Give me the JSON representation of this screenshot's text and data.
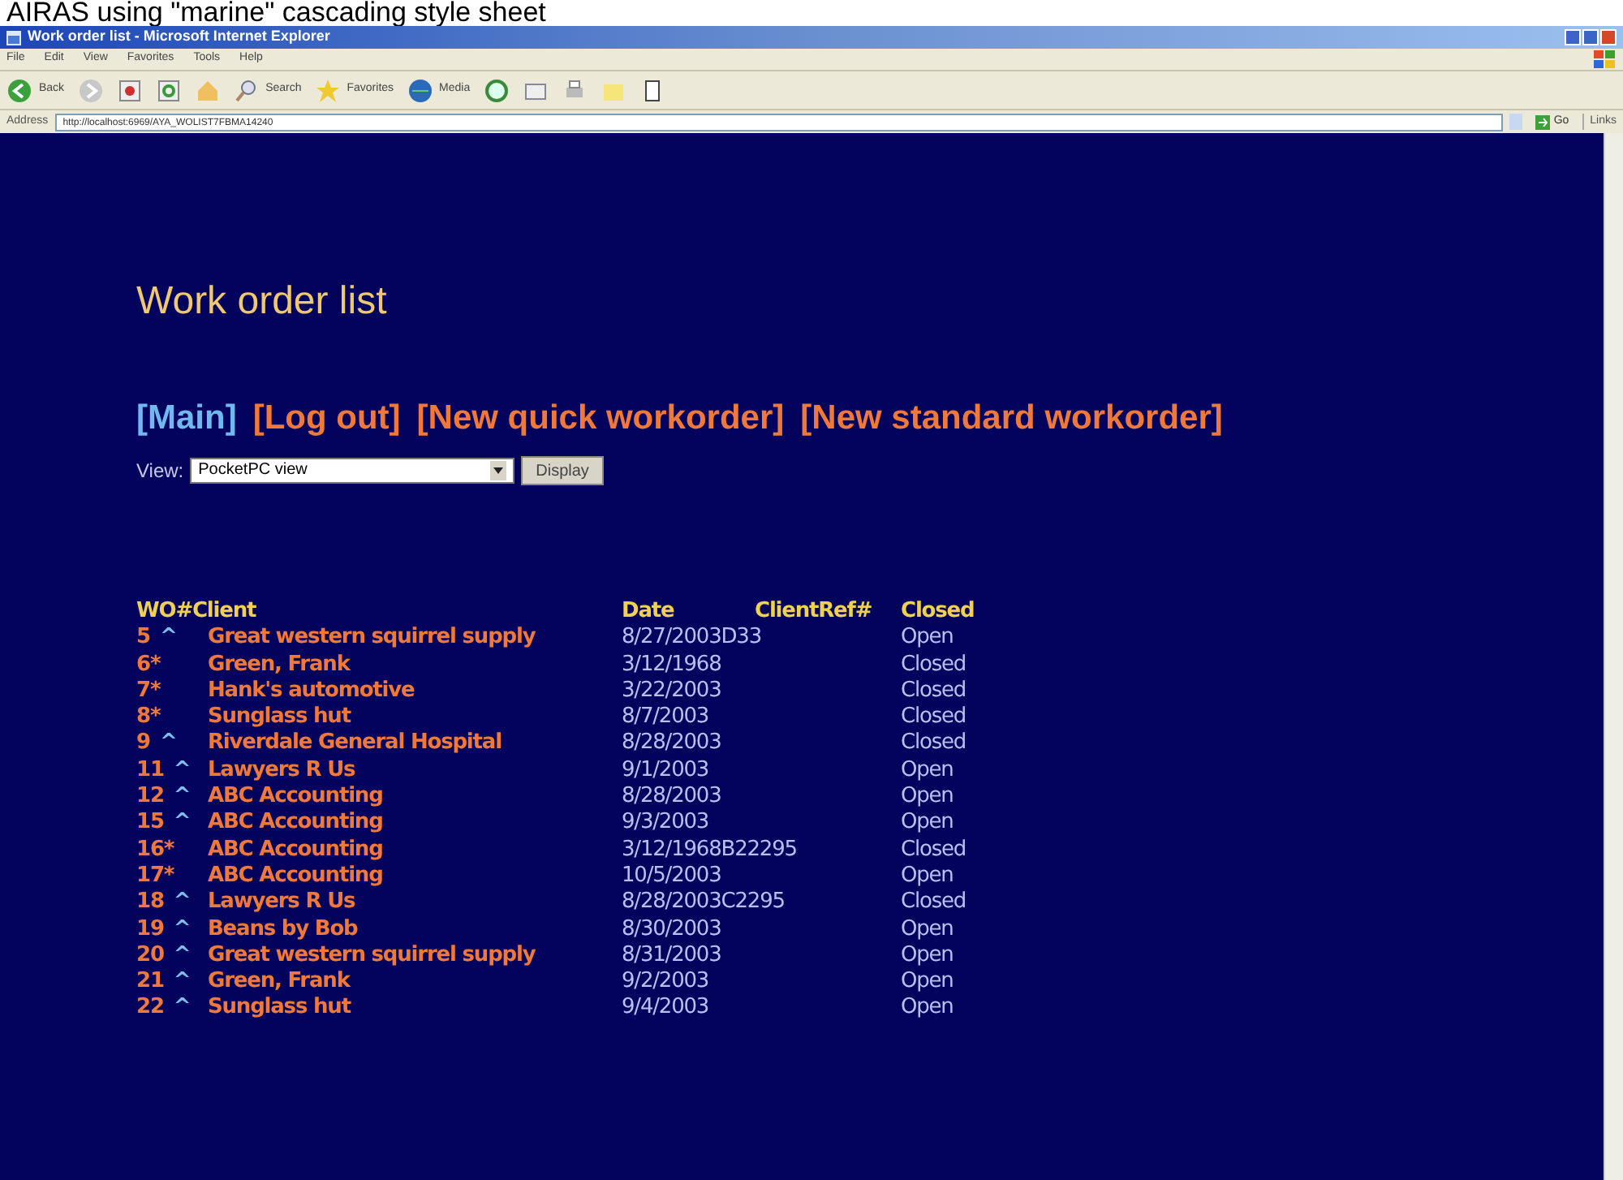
{
  "caption": "AIRAS using \"marine\" cascading style sheet",
  "window": {
    "title": "Work order list - Microsoft Internet Explorer"
  },
  "menu": [
    "File",
    "Edit",
    "View",
    "Favorites",
    "Tools",
    "Help"
  ],
  "toolbar": [
    {
      "kind": "back",
      "label": "Back"
    },
    {
      "kind": "forward"
    },
    {
      "kind": "stop"
    },
    {
      "kind": "refresh"
    },
    {
      "kind": "home"
    },
    {
      "kind": "search",
      "label": "Search"
    },
    {
      "kind": "favorites",
      "label": "Favorites"
    },
    {
      "kind": "media",
      "label": "Media"
    },
    {
      "kind": "history"
    },
    {
      "kind": "mail"
    },
    {
      "kind": "print"
    },
    {
      "kind": "folder"
    },
    {
      "kind": "page"
    }
  ],
  "address": {
    "label": "Address",
    "value": "http://localhost:6969/AYA_WOLIST7FBMA14240",
    "go": "Go",
    "links": "Links"
  },
  "page": {
    "heading": "Work order list",
    "nav": [
      {
        "label": "[Main]",
        "current": true
      },
      {
        "label": "[Log out]",
        "current": false
      },
      {
        "label": "[New quick workorder]",
        "current": false
      },
      {
        "label": "[New standard workorder]",
        "current": false
      }
    ],
    "view": {
      "label": "View:",
      "value": "PocketPC view",
      "button": "Display"
    },
    "table": {
      "columns": [
        "WO#",
        "Client",
        "Date",
        "ClientRef#",
        "Closed"
      ],
      "rows": [
        {
          "wo": "5",
          "kind": "caret",
          "mark": "^",
          "client": "Great western squirrel supply",
          "date": "8/27/2003",
          "ref": "D33",
          "closed": "Open"
        },
        {
          "wo": "6",
          "kind": "star",
          "mark": "*",
          "client": "Green, Frank",
          "date": "3/12/1968",
          "ref": "",
          "closed": "Closed"
        },
        {
          "wo": "7",
          "kind": "star",
          "mark": "*",
          "client": "Hank's automotive",
          "date": "3/22/2003",
          "ref": "",
          "closed": "Closed"
        },
        {
          "wo": "8",
          "kind": "star",
          "mark": "*",
          "client": "Sunglass hut",
          "date": "8/7/2003",
          "ref": "",
          "closed": "Closed"
        },
        {
          "wo": "9",
          "kind": "caret",
          "mark": "^",
          "client": "Riverdale General Hospital",
          "date": "8/28/2003",
          "ref": "",
          "closed": "Closed"
        },
        {
          "wo": "11",
          "kind": "caret",
          "mark": "^",
          "client": "Lawyers R Us",
          "date": "9/1/2003",
          "ref": "",
          "closed": "Open"
        },
        {
          "wo": "12",
          "kind": "caret",
          "mark": "^",
          "client": "ABC Accounting",
          "date": "8/28/2003",
          "ref": "",
          "closed": "Open"
        },
        {
          "wo": "15",
          "kind": "caret",
          "mark": "^",
          "client": "ABC Accounting",
          "date": "9/3/2003",
          "ref": "",
          "closed": "Open"
        },
        {
          "wo": "16",
          "kind": "star",
          "mark": "*",
          "client": "ABC Accounting",
          "date": "3/12/1968",
          "ref": "B22295",
          "closed": "Closed"
        },
        {
          "wo": "17",
          "kind": "star",
          "mark": "*",
          "client": "ABC Accounting",
          "date": "10/5/2003",
          "ref": "",
          "closed": "Open"
        },
        {
          "wo": "18",
          "kind": "caret",
          "mark": "^",
          "client": "Lawyers R Us",
          "date": "8/28/2003",
          "ref": "C2295",
          "closed": "Closed"
        },
        {
          "wo": "19",
          "kind": "caret",
          "mark": "^",
          "client": "Beans by Bob",
          "date": "8/30/2003",
          "ref": "",
          "closed": "Open"
        },
        {
          "wo": "20",
          "kind": "caret",
          "mark": "^",
          "client": "Great western squirrel supply",
          "date": "8/31/2003",
          "ref": "",
          "closed": "Open"
        },
        {
          "wo": "21",
          "kind": "caret",
          "mark": "^",
          "client": "Green, Frank",
          "date": "9/2/2003",
          "ref": "",
          "closed": "Open"
        },
        {
          "wo": "22",
          "kind": "caret",
          "mark": "^",
          "client": "Sunglass hut",
          "date": "9/4/2003",
          "ref": "",
          "closed": "Open"
        }
      ]
    }
  }
}
